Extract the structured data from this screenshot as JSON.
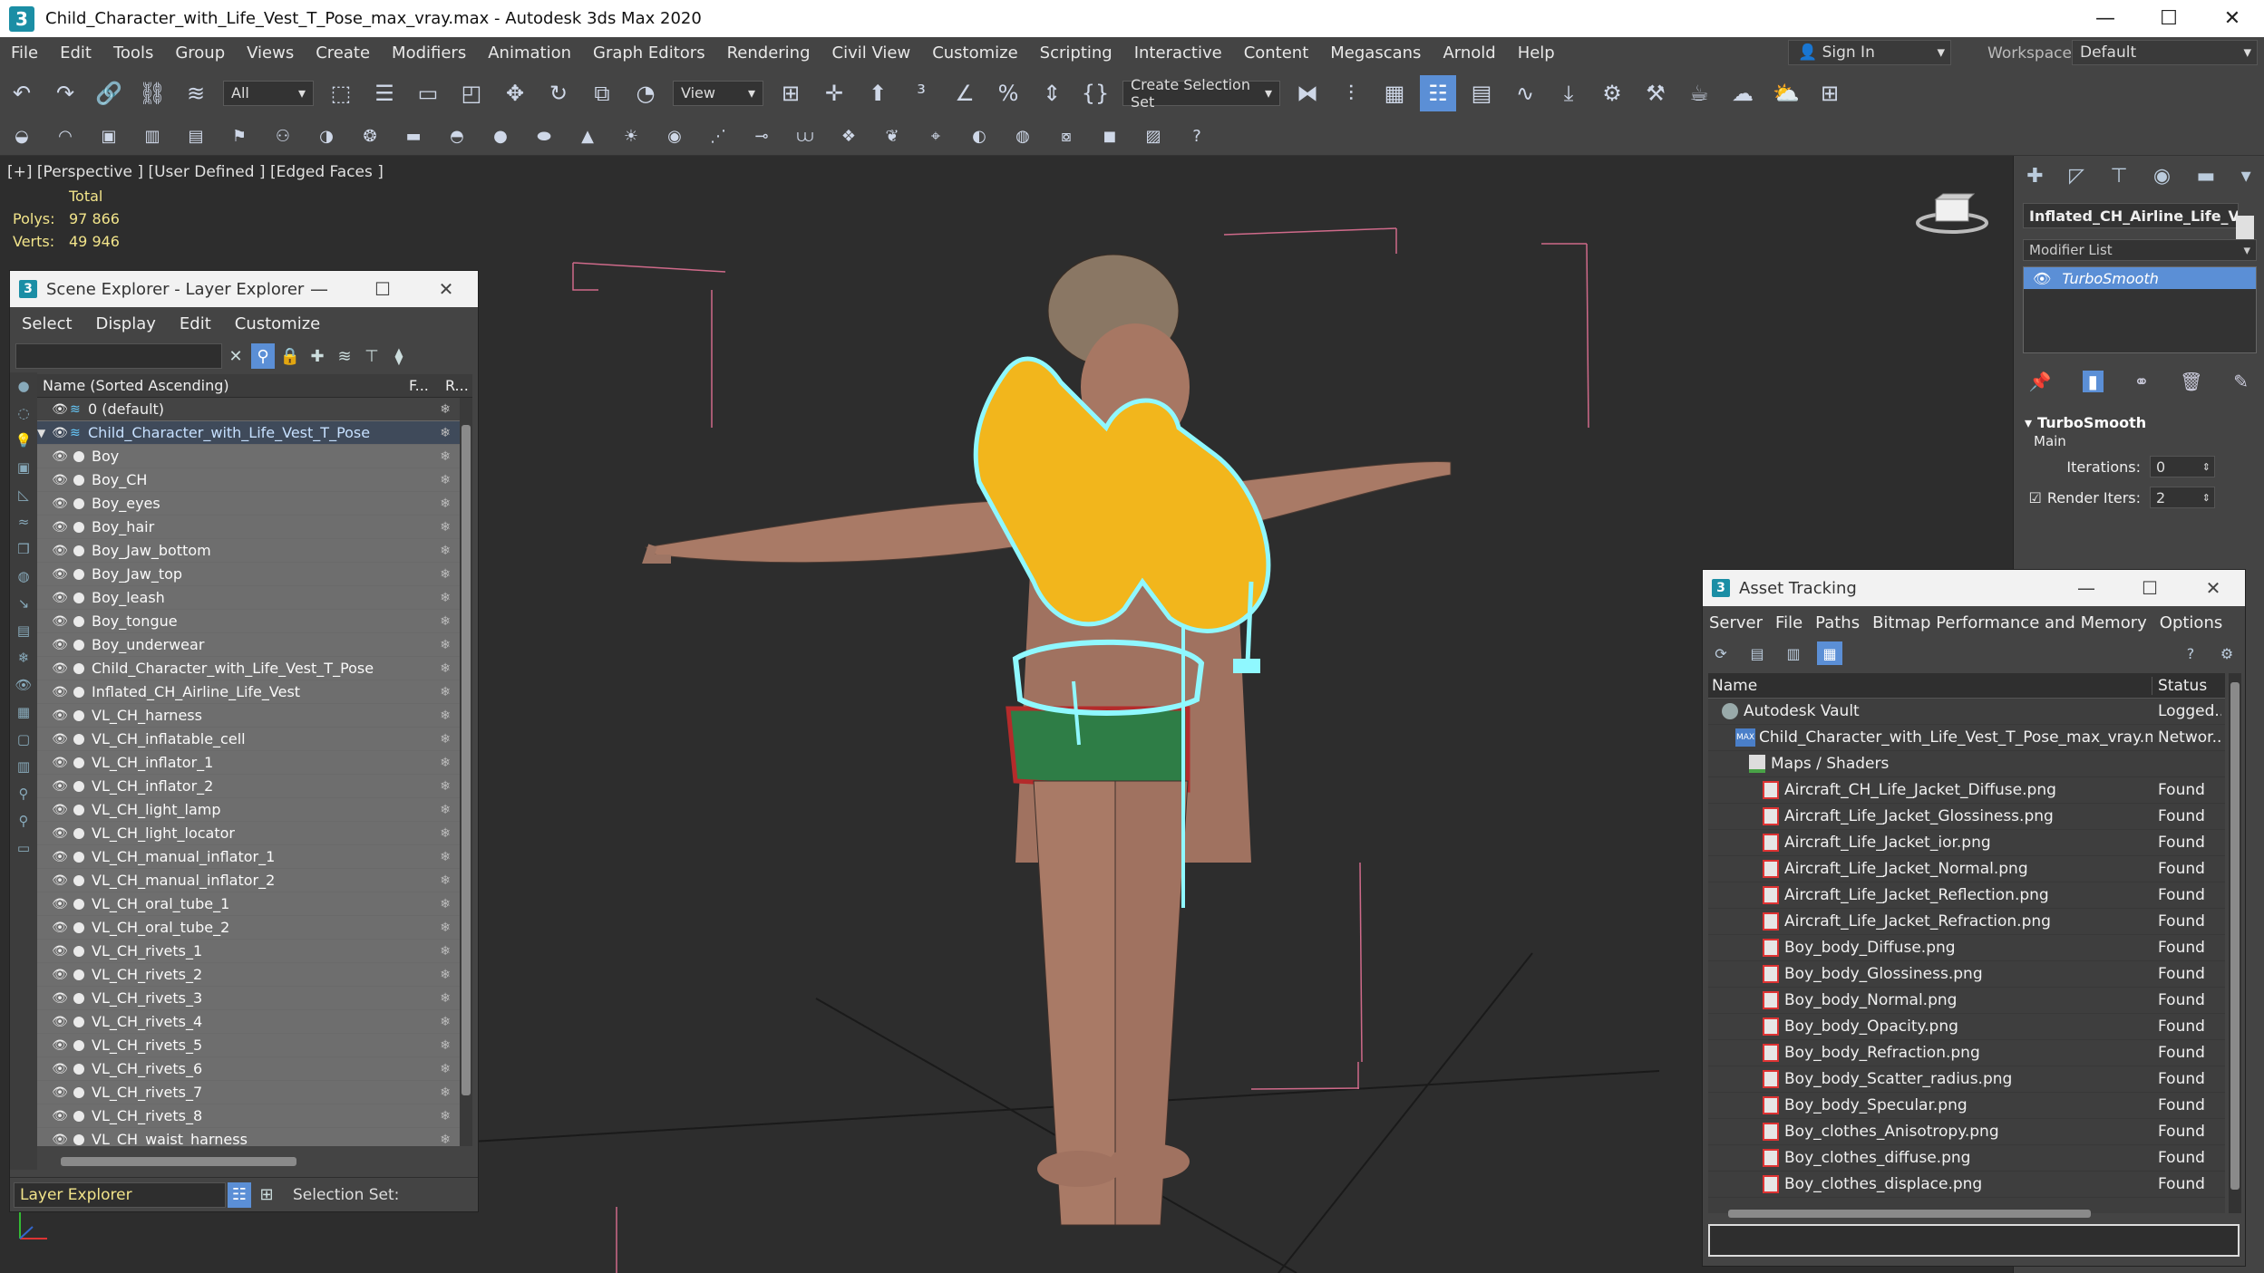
{
  "window": {
    "title": "Child_Character_with_Life_Vest_T_Pose_max_vray.max - Autodesk 3ds Max 2020",
    "logo": "3",
    "controls": [
      "—",
      "☐",
      "✕"
    ]
  },
  "menu": [
    "File",
    "Edit",
    "Tools",
    "Group",
    "Views",
    "Create",
    "Modifiers",
    "Animation",
    "Graph Editors",
    "Rendering",
    "Civil View",
    "Customize",
    "Scripting",
    "Interactive",
    "Content",
    "Megascans",
    "Arnold",
    "Help"
  ],
  "account": {
    "sign_in": "Sign In",
    "workspaces_label": "Workspaces:",
    "workspace": "Default"
  },
  "toolbar": {
    "filter": "All",
    "ref_coord": "View",
    "selection_set": "Create Selection Set"
  },
  "viewport": {
    "label": "[+] [Perspective ] [User Defined ] [Edged Faces ]",
    "stats_header": "Total",
    "polys_label": "Polys:",
    "polys": "97 866",
    "verts_label": "Verts:",
    "verts": "49 946"
  },
  "scene_explorer": {
    "title": "Scene Explorer - Layer Explorer",
    "menu": [
      "Select",
      "Display",
      "Edit",
      "Customize"
    ],
    "col_name": "Name (Sorted Ascending)",
    "col_f": "F...",
    "col_r": "R...",
    "layers": [
      {
        "name": "0 (default)",
        "type": "layer"
      },
      {
        "name": "Child_Character_with_Life_Vest_T_Pose",
        "type": "layer-selected"
      }
    ],
    "objects": [
      "Boy",
      "Boy_CH",
      "Boy_eyes",
      "Boy_hair",
      "Boy_Jaw_bottom",
      "Boy_Jaw_top",
      "Boy_leash",
      "Boy_tongue",
      "Boy_underwear",
      "Child_Character_with_Life_Vest_T_Pose",
      "Inflated_CH_Airline_Life_Vest",
      "VL_CH_harness",
      "VL_CH_inflatable_cell",
      "VL_CH_inflator_1",
      "VL_CH_inflator_2",
      "VL_CH_light_lamp",
      "VL_CH_light_locator",
      "VL_CH_manual_inflator_1",
      "VL_CH_manual_inflator_2",
      "VL_CH_oral_tube_1",
      "VL_CH_oral_tube_2",
      "VL_CH_rivets_1",
      "VL_CH_rivets_2",
      "VL_CH_rivets_3",
      "VL_CH_rivets_4",
      "VL_CH_rivets_5",
      "VL_CH_rivets_6",
      "VL_CH_rivets_7",
      "VL_CH_rivets_8",
      "VL_CH_waist_harness"
    ],
    "footer_mode": "Layer Explorer",
    "selection_set_label": "Selection Set:"
  },
  "command_panel": {
    "object_name": "Inflated_CH_Airline_Life_Vest",
    "modifier_list": "Modifier List",
    "modifier": "TurboSmooth",
    "rollout_title": "TurboSmooth",
    "rollout_sub": "Main",
    "iterations_label": "Iterations:",
    "iterations": "0",
    "render_iters_label": "Render Iters:",
    "render_iters": "2"
  },
  "asset_tracking": {
    "title": "Asset Tracking",
    "menu": [
      "Server",
      "File",
      "Paths",
      "Bitmap Performance and Memory",
      "Options"
    ],
    "col_name": "Name",
    "col_status": "Status",
    "rows": [
      {
        "name": "Autodesk Vault",
        "status": "Logged...",
        "indent": 1,
        "icon": "vault"
      },
      {
        "name": "Child_Character_with_Life_Vest_T_Pose_max_vray.max",
        "status": "Networ...",
        "indent": 2,
        "icon": "max"
      },
      {
        "name": "Maps / Shaders",
        "status": "",
        "indent": 3,
        "icon": "dir"
      },
      {
        "name": "Aircraft_CH_Life_Jacket_Diffuse.png",
        "status": "Found",
        "indent": 4,
        "icon": "file"
      },
      {
        "name": "Aircraft_Life_Jacket_Glossiness.png",
        "status": "Found",
        "indent": 4,
        "icon": "file"
      },
      {
        "name": "Aircraft_Life_Jacket_ior.png",
        "status": "Found",
        "indent": 4,
        "icon": "file"
      },
      {
        "name": "Aircraft_Life_Jacket_Normal.png",
        "status": "Found",
        "indent": 4,
        "icon": "file"
      },
      {
        "name": "Aircraft_Life_Jacket_Reflection.png",
        "status": "Found",
        "indent": 4,
        "icon": "file"
      },
      {
        "name": "Aircraft_Life_Jacket_Refraction.png",
        "status": "Found",
        "indent": 4,
        "icon": "file"
      },
      {
        "name": "Boy_body_Diffuse.png",
        "status": "Found",
        "indent": 4,
        "icon": "file"
      },
      {
        "name": "Boy_body_Glossiness.png",
        "status": "Found",
        "indent": 4,
        "icon": "file"
      },
      {
        "name": "Boy_body_Normal.png",
        "status": "Found",
        "indent": 4,
        "icon": "file"
      },
      {
        "name": "Boy_body_Opacity.png",
        "status": "Found",
        "indent": 4,
        "icon": "file"
      },
      {
        "name": "Boy_body_Refraction.png",
        "status": "Found",
        "indent": 4,
        "icon": "file"
      },
      {
        "name": "Boy_body_Scatter_radius.png",
        "status": "Found",
        "indent": 4,
        "icon": "file"
      },
      {
        "name": "Boy_body_Specular.png",
        "status": "Found",
        "indent": 4,
        "icon": "file"
      },
      {
        "name": "Boy_clothes_Anisotropy.png",
        "status": "Found",
        "indent": 4,
        "icon": "file"
      },
      {
        "name": "Boy_clothes_diffuse.png",
        "status": "Found",
        "indent": 4,
        "icon": "file"
      },
      {
        "name": "Boy_clothes_displace.png",
        "status": "Found",
        "indent": 4,
        "icon": "file"
      }
    ]
  },
  "colors": {
    "accent": "#5b8fd6",
    "stats": "#f2e48a",
    "selection_wire": "#8ff8ff",
    "vest": "#f2b61c",
    "skin": "#b07d68"
  }
}
